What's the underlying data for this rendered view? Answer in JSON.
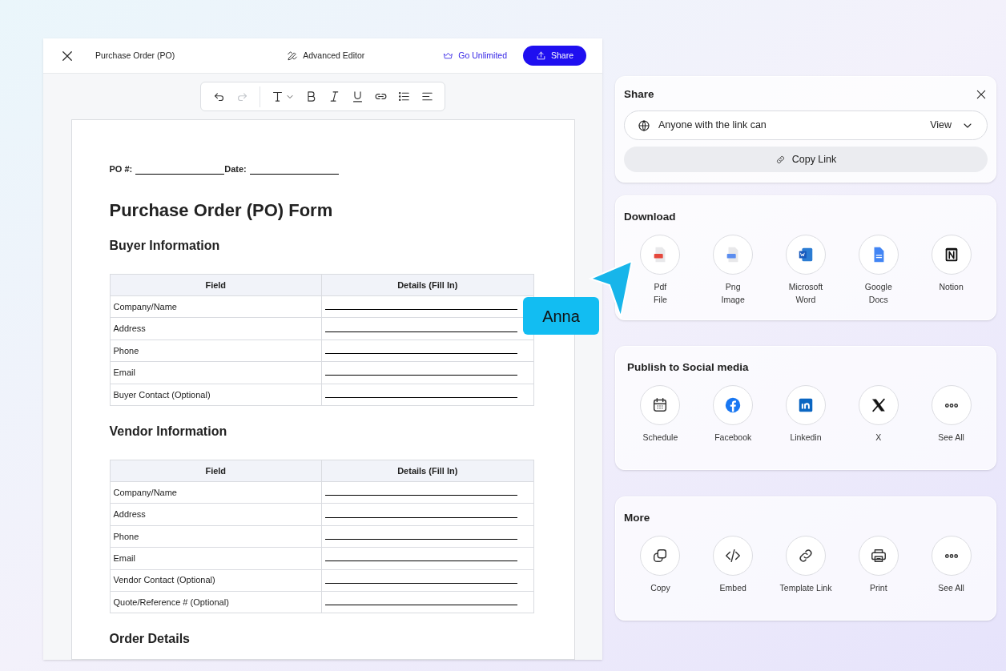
{
  "editor": {
    "title": "Purchase Order (PO)",
    "mode": "Advanced Editor",
    "upgrade": "Go Unlimited",
    "share_button": "Share"
  },
  "toolbar": [
    {
      "kind": "undo",
      "disabled": false
    },
    {
      "kind": "redo",
      "disabled": true
    },
    {
      "kind": "text",
      "disabled": false
    },
    {
      "kind": "bold",
      "disabled": false
    },
    {
      "kind": "italic",
      "disabled": false
    },
    {
      "kind": "underline",
      "disabled": false
    },
    {
      "kind": "link",
      "disabled": false
    },
    {
      "kind": "list",
      "disabled": false
    },
    {
      "kind": "align",
      "disabled": false
    }
  ],
  "document": {
    "po_label": "PO #:",
    "date_label": "Date:",
    "title": "Purchase Order (PO) Form",
    "sections": [
      {
        "heading": "Buyer Information",
        "columns": [
          "Field",
          "Details (Fill In)"
        ],
        "rows": [
          "Company/Name",
          "Address",
          "Phone",
          "Email",
          "Buyer Contact (Optional)"
        ]
      },
      {
        "heading": "Vendor Information",
        "columns": [
          "Field",
          "Details (Fill In)"
        ],
        "rows": [
          "Company/Name",
          "Address",
          "Phone",
          "Email",
          "Vendor Contact (Optional)",
          "Quote/Reference # (Optional)"
        ]
      },
      {
        "heading": "Order Details"
      }
    ]
  },
  "cursor": {
    "name": "Anna"
  },
  "share": {
    "title": "Share",
    "access": "Anyone with the link can",
    "permission": "View",
    "copy_link": "Copy Link"
  },
  "groups": [
    {
      "title": "Download",
      "items": [
        {
          "kind": "pdf",
          "label": "Pdf\nFile"
        },
        {
          "kind": "png",
          "label": "Png\nImage"
        },
        {
          "kind": "word",
          "label": "Microsoft\nWord"
        },
        {
          "kind": "gdocs",
          "label": "Google\nDocs"
        },
        {
          "kind": "notion",
          "label": "Notion"
        }
      ]
    },
    {
      "title": "Publish to Social media",
      "items": [
        {
          "kind": "calendar",
          "label": "Schedule"
        },
        {
          "kind": "facebook",
          "label": "Facebook"
        },
        {
          "kind": "linkedin",
          "label": "Linkedin"
        },
        {
          "kind": "x",
          "label": "X"
        },
        {
          "kind": "more",
          "label": "See All"
        }
      ]
    },
    {
      "title": "More",
      "items": [
        {
          "kind": "copy",
          "label": "Copy"
        },
        {
          "kind": "embed",
          "label": "Embed"
        },
        {
          "kind": "link",
          "label": "Template Link"
        },
        {
          "kind": "print",
          "label": "Print"
        },
        {
          "kind": "more",
          "label": "See All"
        }
      ]
    }
  ]
}
